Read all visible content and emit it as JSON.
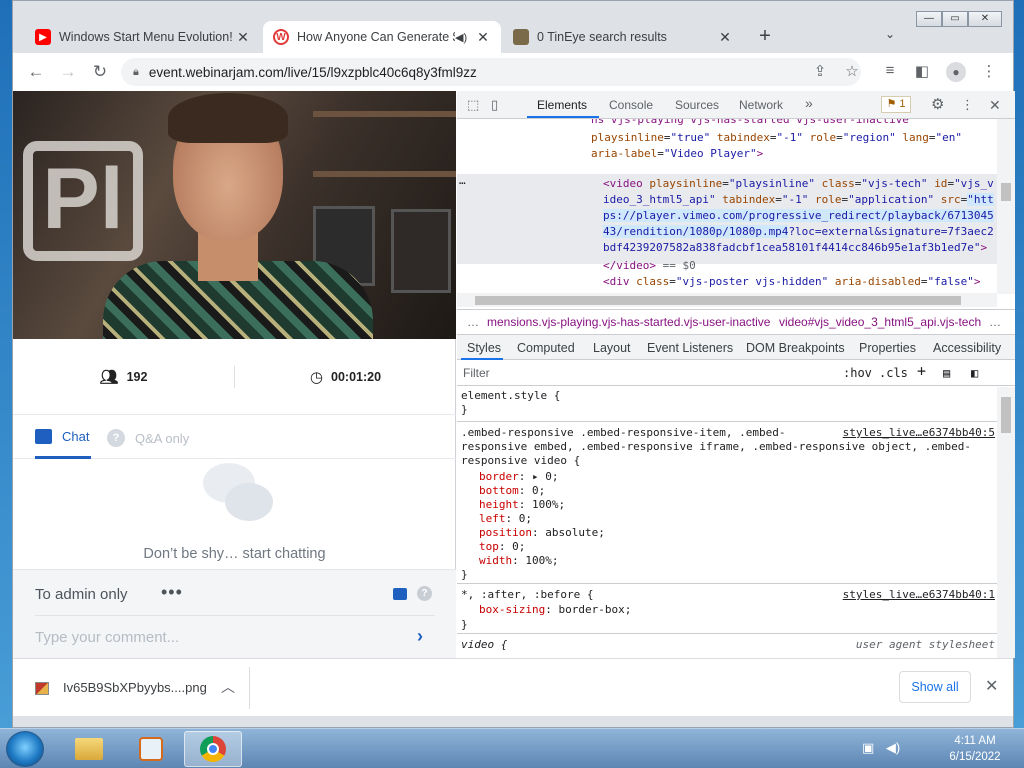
{
  "tabs": [
    {
      "title": "Windows Start Menu Evolution! | ",
      "icon": "youtube-icon",
      "color": "#ff0000"
    },
    {
      "title": "How Anyone Can Generate $",
      "icon": "webinarjam-icon",
      "color": "#e23a3a",
      "active": true
    },
    {
      "title": "0 TinEye search results",
      "icon": "tineye-icon",
      "color": "#6a5a3a"
    }
  ],
  "toolbar": {
    "url": "event.webinarjam.com/live/15/l9xzpblc40c6q8y3fml9zz"
  },
  "webinar": {
    "attendees": "192",
    "elapsed": "00:01:20",
    "chat_tab": "Chat",
    "qa_tab": "Q&A only",
    "qa_icon": "?",
    "empty_text": "Don’t be shy… start chatting",
    "to_admin": "To admin only",
    "more_dots": "•••",
    "comment_placeholder": "Type your comment..."
  },
  "devtools": {
    "tabs": [
      "Elements",
      "Console",
      "Sources",
      "Network"
    ],
    "more_tabs": "»",
    "issues_count": "1",
    "dom_lines": [
      "ns vjs-playing vjs-has-started vjs-user-inactive\"",
      "playsinline=\"true\" tabindex=\"-1\" role=\"region\" lang=\"en\"",
      "aria-label=\"Video Player\">",
      "<video playsinline=\"playsinline\" class=\"vjs-tech\" id=\"vjs_v",
      "ideo_3_html5_api\" tabindex=\"-1\" role=\"application\" src=\"htt",
      "ps://player.vimeo.com/progressive_redirect/playback/6713045",
      "43/rendition/1080p/1080p.mp4?loc=external&signature=7f3aec2",
      "bdf4239207582a838fadcbf1cea58101f4414cc846b95e1af3b1ed7e\">",
      "</video> == $0",
      "<div class=\"vjs-poster vjs-hidden\" aria-disabled=\"false\">"
    ],
    "ellipsis": "…",
    "crumb1": "mensions.vjs-playing.vjs-has-started.vjs-user-inactive",
    "crumb2": "video#vjs_video_3_html5_api.vjs-tech",
    "crumb_more": "…",
    "sub_tabs": [
      "Styles",
      "Computed",
      "Layout",
      "Event Listeners",
      "DOM Breakpoints",
      "Properties",
      "Accessibility"
    ],
    "filter_placeholder": "Filter",
    "hov": ":hov",
    "cls": ".cls",
    "plus": "+",
    "element_style": "element.style {",
    "close_brace": "}",
    "rule1_selector": [
      ".embed-responsive .embed-responsive-item, .embed-",
      "responsive embed, .embed-responsive iframe, .embed-responsive object, .embed-",
      "responsive video {"
    ],
    "rule1_source": "styles_live…e6374bb40:5",
    "rule1_props": [
      {
        "name": "border",
        "value": "▸ 0;"
      },
      {
        "name": "bottom",
        "value": "0;"
      },
      {
        "name": "height",
        "value": "100%;"
      },
      {
        "name": "left",
        "value": "0;"
      },
      {
        "name": "position",
        "value": "absolute;"
      },
      {
        "name": "top",
        "value": "0;"
      },
      {
        "name": "width",
        "value": "100%;"
      }
    ],
    "rule2_selector": "*, :after, :before {",
    "rule2_source": "styles_live…e6374bb40:1",
    "rule2_prop": {
      "name": "box-sizing",
      "value": "border-box;"
    },
    "rule3_selector": "video {",
    "rule3_source": "user agent stylesheet"
  },
  "download": {
    "filename": "Iv65B9SbXPbyybs....png",
    "show_all": "Show all"
  },
  "taskbar": {
    "time": "4:11 AM",
    "date": "6/15/2022"
  }
}
